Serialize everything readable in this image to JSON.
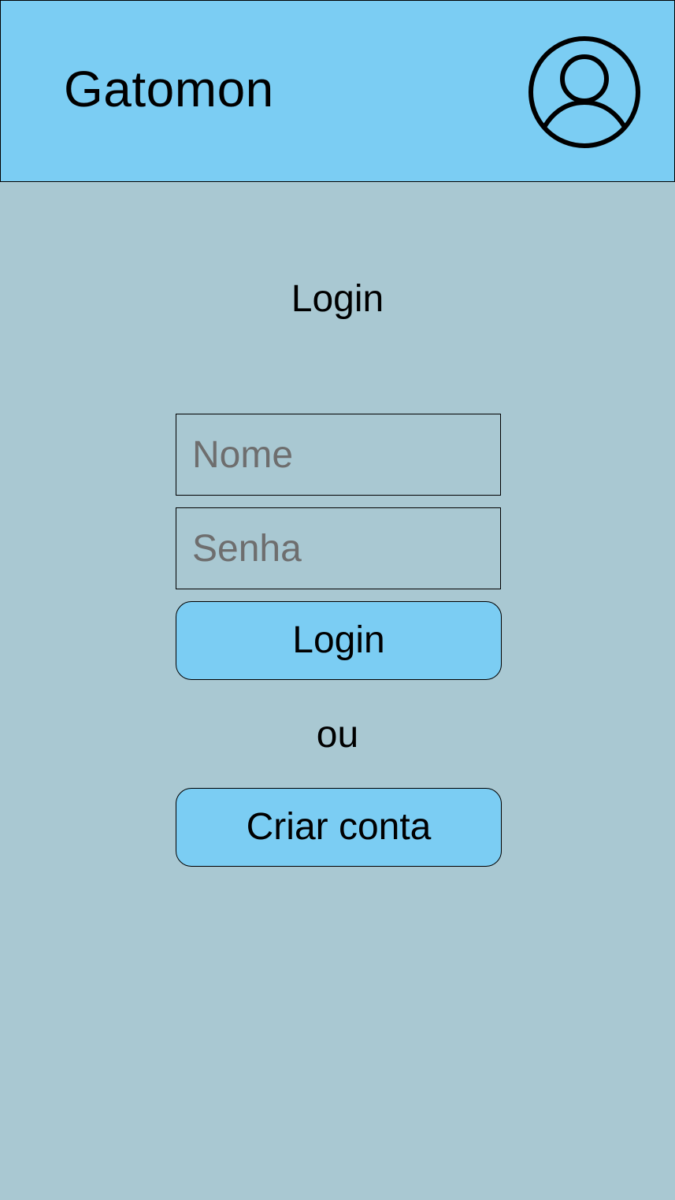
{
  "header": {
    "app_title": "Gatomon",
    "avatar_icon": "user-circle-icon"
  },
  "login": {
    "heading": "Login",
    "name_placeholder": "Nome",
    "password_placeholder": "Senha",
    "login_button_label": "Login",
    "or_text": "ou",
    "create_account_label": "Criar conta"
  },
  "colors": {
    "header_bg": "#7bcdf3",
    "page_bg": "#a9c8d2",
    "button_bg": "#7bcdf3",
    "placeholder": "#6e6e6e"
  }
}
